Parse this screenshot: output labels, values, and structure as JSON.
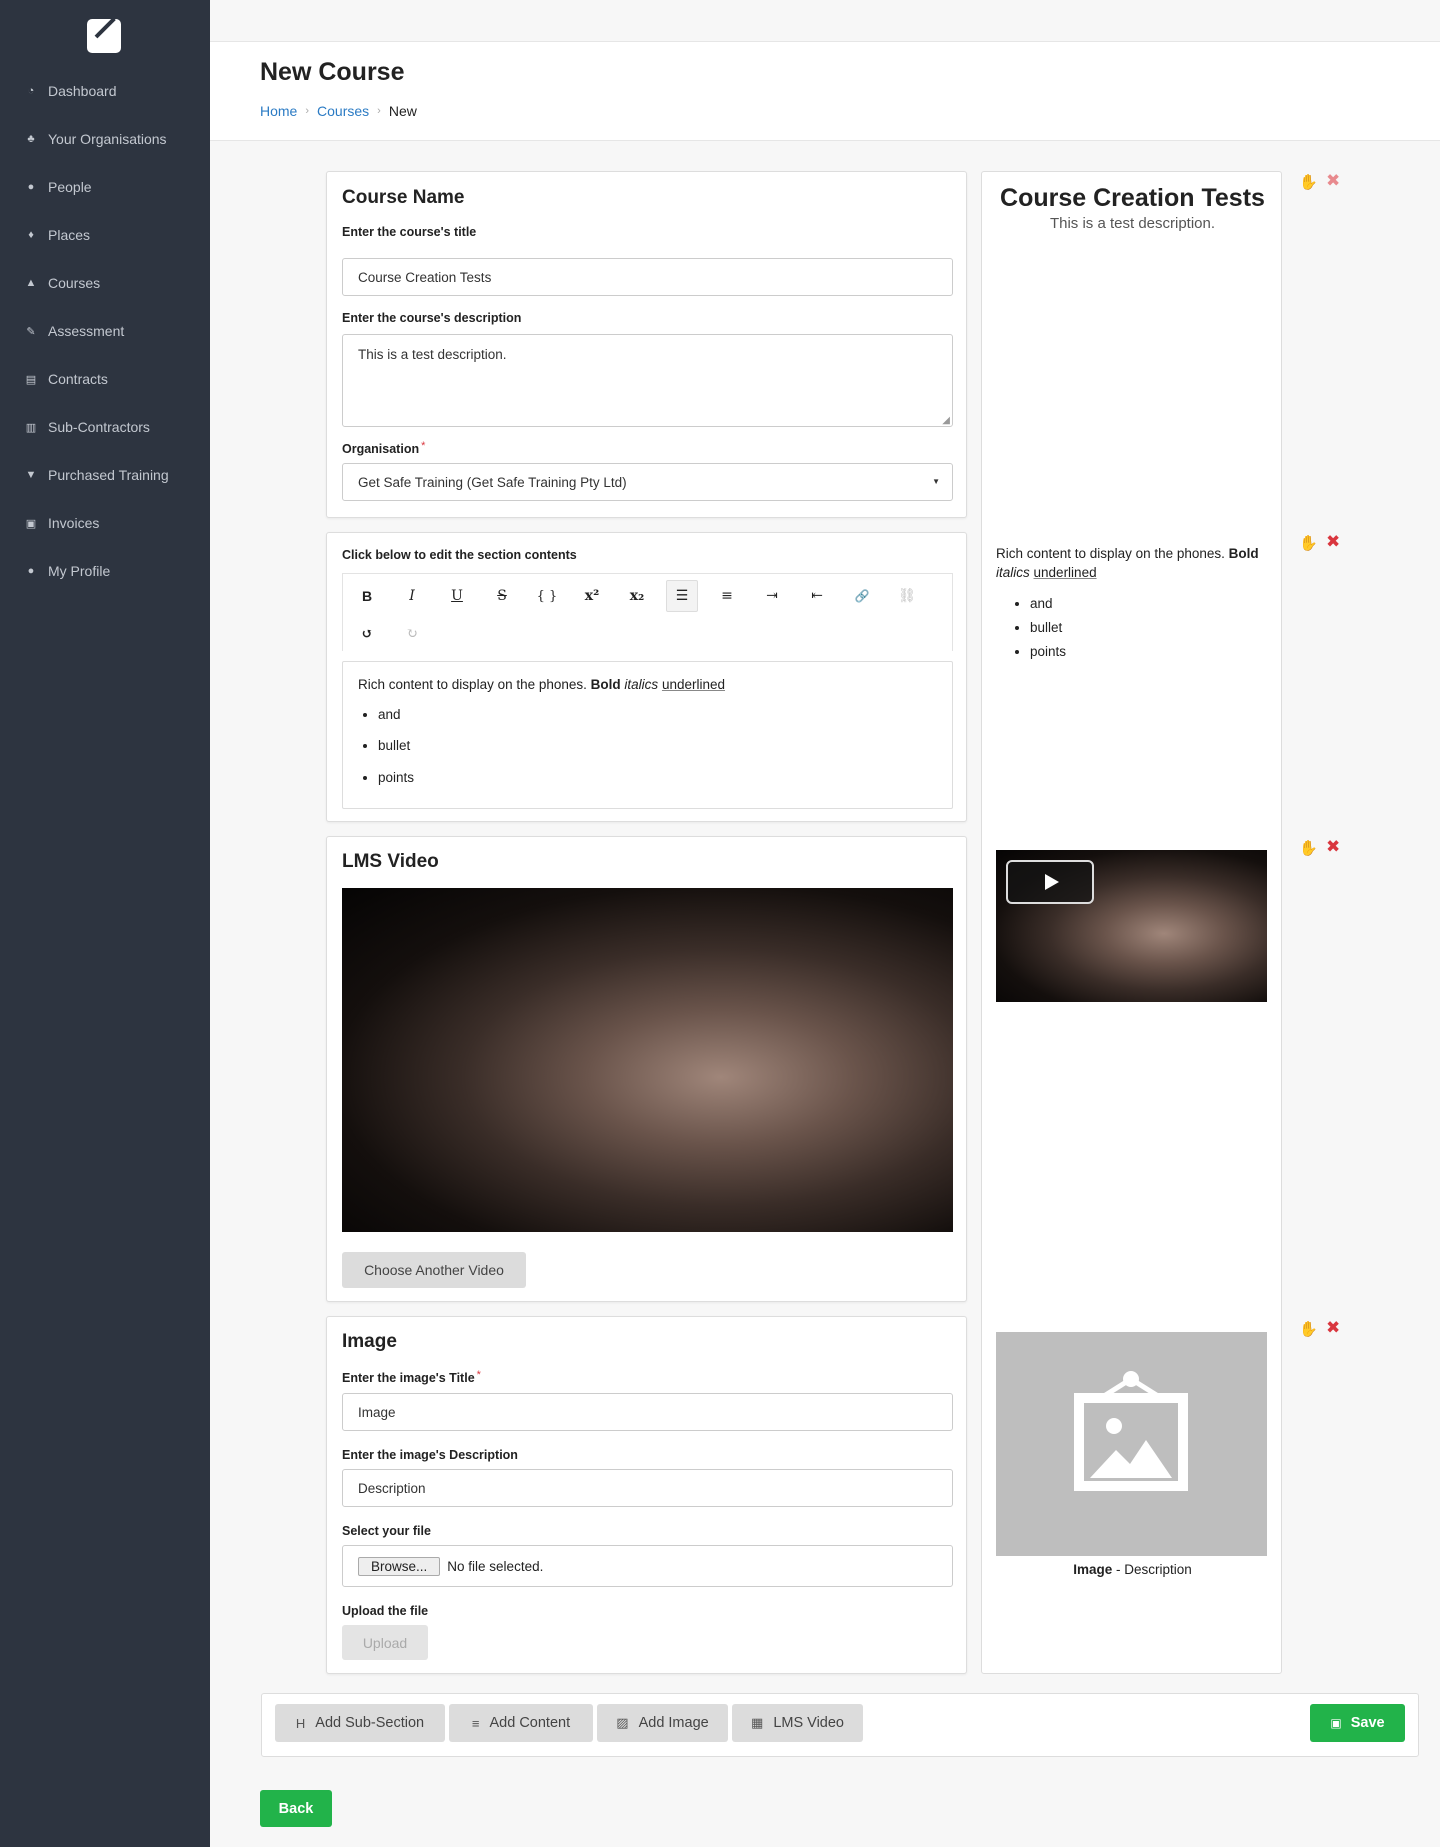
{
  "sidebar": {
    "items": [
      {
        "icon": "dashboard-icon",
        "glyph": "◔",
        "label": "Dashboard"
      },
      {
        "icon": "organisations-icon",
        "glyph": "♣",
        "label": "Your Organisations"
      },
      {
        "icon": "people-icon",
        "glyph": "●",
        "label": "People"
      },
      {
        "icon": "map-pin-icon",
        "glyph": "♦",
        "label": "Places"
      },
      {
        "icon": "graduation-cap-icon",
        "glyph": "▲",
        "label": "Courses"
      },
      {
        "icon": "pencil-icon",
        "glyph": "✎",
        "label": "Assessment"
      },
      {
        "icon": "document-icon",
        "glyph": "▤",
        "label": "Contracts"
      },
      {
        "icon": "bar-chart-icon",
        "glyph": "▥",
        "label": "Sub-Contractors"
      },
      {
        "icon": "cart-icon",
        "glyph": "▼",
        "label": "Purchased Training"
      },
      {
        "icon": "money-icon",
        "glyph": "▣",
        "label": "Invoices"
      },
      {
        "icon": "user-icon",
        "glyph": "●",
        "label": "My Profile"
      }
    ]
  },
  "header": {
    "title": "New Course",
    "breadcrumb": {
      "home": "Home",
      "courses": "Courses",
      "current": "New"
    }
  },
  "course_name": {
    "title": "Course Name",
    "title_label": "Enter the course's title",
    "title_value": "Course Creation Tests",
    "description_label": "Enter the course's description",
    "description_value": "This is a test description.",
    "organisation_label": "Organisation",
    "organisation_value": "Get Safe Training (Get Safe Training Pty Ltd)"
  },
  "content_section": {
    "label": "Click below to edit the section contents",
    "toolbar": {
      "bold": "B",
      "italic": "I",
      "underline": "U",
      "strike": "S",
      "code": "{ }",
      "superscript": "x²",
      "subscript": "x₂",
      "bullet_list": "☰",
      "ordered_list": "≡",
      "indent": "⇥",
      "outdent": "⇤",
      "link": "🔗",
      "unlink": "⛓",
      "undo": "↺",
      "redo": "↻"
    },
    "rich_text": {
      "plain": "Rich content to display on the phones. ",
      "bold": "Bold",
      "italic": "italics",
      "underline": "underlined",
      "bullets": [
        "and",
        "bullet",
        "points"
      ]
    }
  },
  "video_section": {
    "title": "LMS Video",
    "choose_button": "Choose Another Video"
  },
  "image_section": {
    "title": "Image",
    "title_label": "Enter the image's Title",
    "title_value": "Image",
    "description_label": "Enter the image's Description",
    "description_value": "Description",
    "file_label": "Select your file",
    "browse_button": "Browse...",
    "file_status": "No file selected.",
    "upload_label": "Upload the file",
    "upload_button": "Upload"
  },
  "preview": {
    "title": "Course Creation Tests",
    "description": "This is a test description.",
    "image_caption_title": "Image",
    "image_caption_sep": " - ",
    "image_caption_desc": "Description"
  },
  "controls": {
    "drag_glyph": "✋",
    "delete_glyph": "✖"
  },
  "bottom_bar": {
    "add_subsection": "Add Sub-Section",
    "add_content": "Add Content",
    "add_image": "Add Image",
    "lms_video": "LMS Video",
    "save": "Save",
    "icons": {
      "heading": "H",
      "content": "≡",
      "image": "▨",
      "film": "▦",
      "save": "▣"
    }
  },
  "back_button": "Back"
}
